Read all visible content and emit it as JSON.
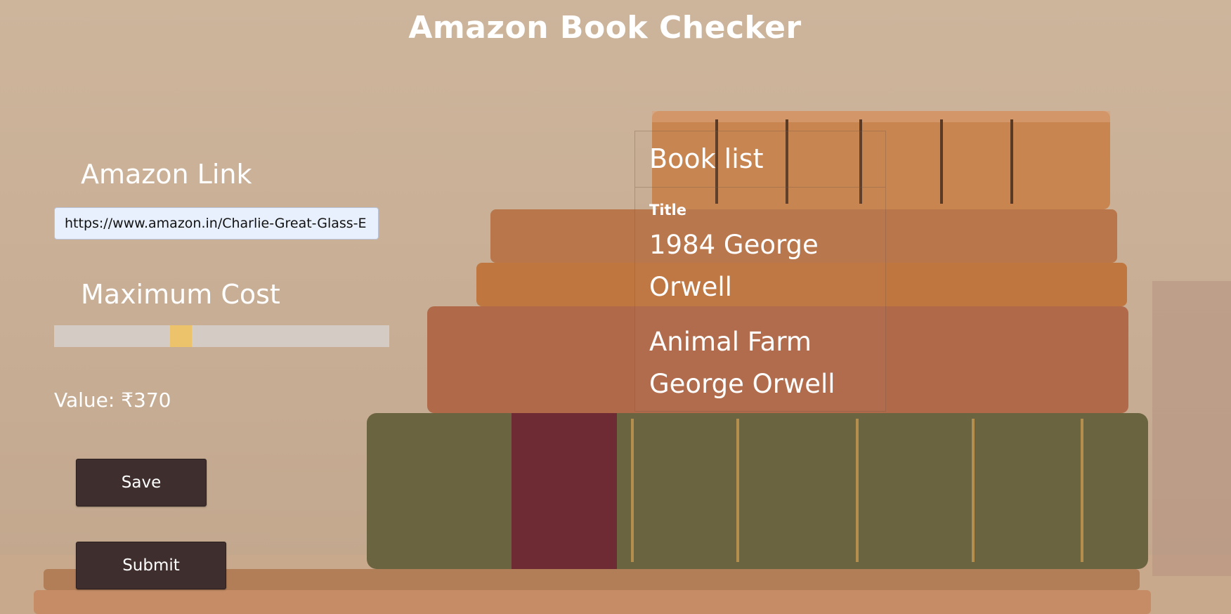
{
  "app": {
    "title": "Amazon Book Checker"
  },
  "form": {
    "link_label": "Amazon Link",
    "link_value": "https://www.amazon.in/Charlie-Great-Glass-E",
    "cost_label": "Maximum Cost",
    "cost_slider": {
      "position_fraction": 0.37
    },
    "value_text": "Value: ₹370"
  },
  "buttons": {
    "save_label": "Save",
    "submit_label": "Submit"
  },
  "book_list": {
    "heading": "Book list",
    "column_header": "Title",
    "items": [
      {
        "title": "1984 George Orwell"
      },
      {
        "title": "Animal Farm George Orwell"
      }
    ]
  },
  "colors": {
    "button_bg": "#3f2e2e",
    "slider_thumb": "#ecc36a",
    "slider_track": "#d4cbc4",
    "input_bg": "#e8f0fe"
  }
}
